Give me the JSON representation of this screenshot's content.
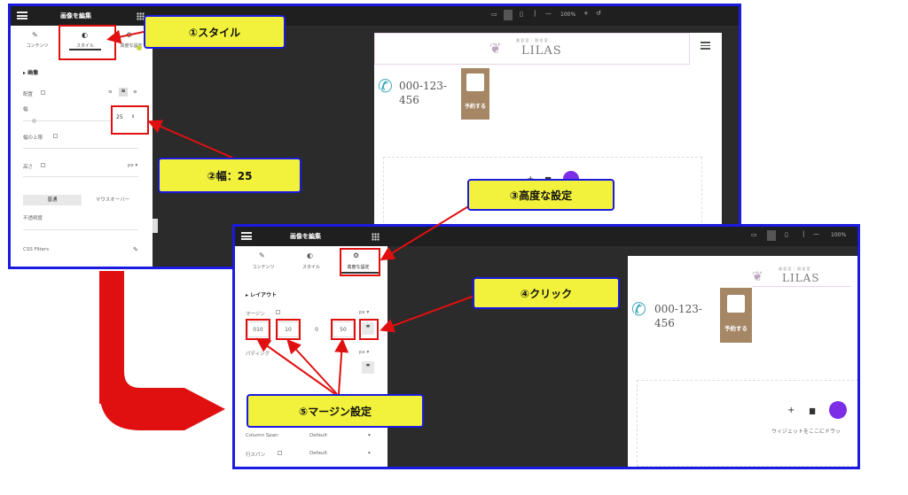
{
  "shot1": {
    "panel_title": "画像を編集",
    "tabs": [
      "コンテンツ",
      "スタイル",
      "高度な設定"
    ],
    "section": "画像",
    "align_label": "配置",
    "width_label": "幅",
    "width_value": "25",
    "max_width_label": "幅の上限",
    "height_label": "高さ",
    "height_unit": "px",
    "state_tabs": [
      "普通",
      "マウスオーバー"
    ],
    "opacity_label": "不透明度",
    "css_filters_label": "CSS Filters",
    "zoom": "100%",
    "logo_small": "美 容 室 ｜ 脱 毛 室",
    "logo": "LILAS",
    "phone": "000-123-456",
    "reserve": "予約する"
  },
  "shot2": {
    "panel_title": "画像を編集",
    "tabs": [
      "コンテンツ",
      "スタイル",
      "高度な設定"
    ],
    "section": "レイアウト",
    "margin_label": "マージン",
    "margin_values": [
      "010",
      "10",
      "0",
      "50"
    ],
    "margin_unit": "px",
    "padding_label": "パディング",
    "padding_unit": "px",
    "col_span_label": "Column Span",
    "row_span_label": "行スパン",
    "default_label": "Default",
    "zoom": "100%",
    "logo_small": "美 容 室 ｜ 脱 毛 室",
    "logo": "LILAS",
    "phone": "000-123-456",
    "reserve": "予約する",
    "drop_hint": "ウィジェットをここにドラッ"
  },
  "callouts": {
    "c1": "①スタイル",
    "c2": "②幅：25",
    "c3": "③高度な設定",
    "c4": "④クリック",
    "c5": "⑤マージン設定"
  },
  "colors": {
    "frame": "#1a1ae0",
    "highlight": "#e01010",
    "callout_bg": "#f2f23c",
    "reserve_bg": "#a58766",
    "phone": "#3aa6b9",
    "widget_purple": "#7c2ee6"
  }
}
